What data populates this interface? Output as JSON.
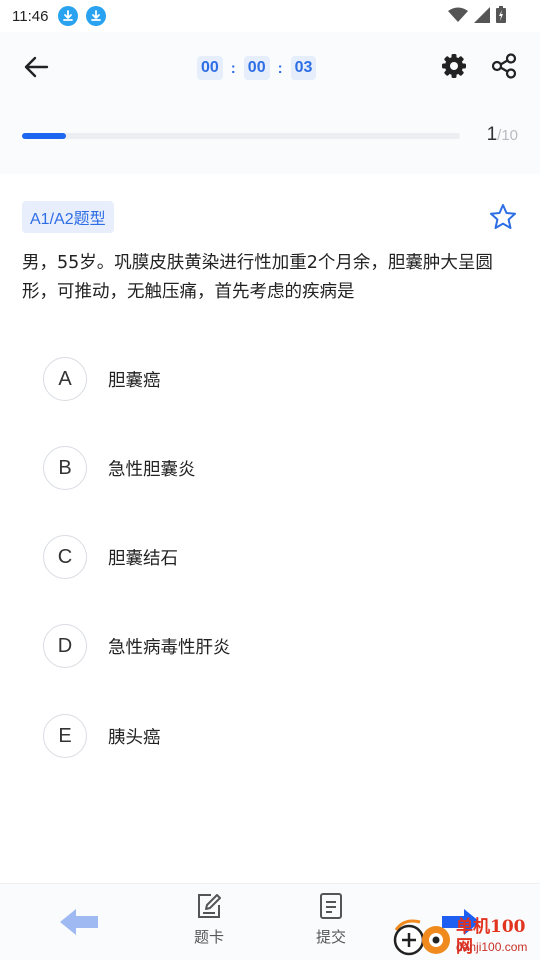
{
  "status_bar": {
    "time": "11:46"
  },
  "header": {
    "timer": {
      "hours": "00",
      "minutes": "00",
      "seconds": "03",
      "separator": ":"
    },
    "progress": {
      "current": "1",
      "separator": "/",
      "total": "10",
      "fraction": 0.1
    }
  },
  "question": {
    "type_label": "A1/A2题型",
    "text": "男，55岁。巩膜皮肤黄染进行性加重2个月余，胆囊肿大呈圆形，可推动，无触压痛，首先考虑的疾病是",
    "options": [
      {
        "letter": "A",
        "text": "胆囊癌"
      },
      {
        "letter": "B",
        "text": "急性胆囊炎"
      },
      {
        "letter": "C",
        "text": "胆囊结石"
      },
      {
        "letter": "D",
        "text": "急性病毒性肝炎"
      },
      {
        "letter": "E",
        "text": "胰头癌"
      }
    ]
  },
  "bottom_bar": {
    "card_label": "题卡",
    "submit_label": "提交"
  },
  "watermark": {
    "name": "单机100网",
    "url": "danji100.com"
  },
  "colors": {
    "accent": "#1e66f0",
    "nav_prev": "#9fb9f3",
    "nav_next": "#1e5ef0",
    "badge_bg": "#e8eefb"
  }
}
